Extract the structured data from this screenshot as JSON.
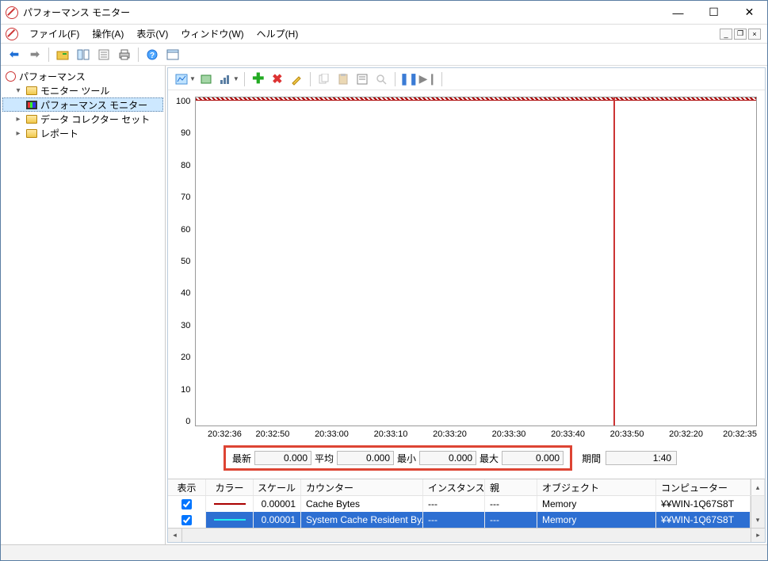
{
  "window": {
    "title": "パフォーマンス モニター"
  },
  "menu": {
    "file": "ファイル(F)",
    "action": "操作(A)",
    "view": "表示(V)",
    "window": "ウィンドウ(W)",
    "help": "ヘルプ(H)"
  },
  "tree": {
    "root": "パフォーマンス",
    "item0": "モニター ツール",
    "item0_0": "パフォーマンス モニター",
    "item1": "データ コレクター セット",
    "item2": "レポート"
  },
  "stats": {
    "latest_label": "最新",
    "latest": "0.000",
    "avg_label": "平均",
    "avg": "0.000",
    "min_label": "最小",
    "min": "0.000",
    "max_label": "最大",
    "max": "0.000",
    "period_label": "期間",
    "period": "1:40"
  },
  "list": {
    "headers": {
      "show": "表示",
      "color": "カラー",
      "scale": "スケール",
      "counter": "カウンター",
      "instance": "インスタンス",
      "parent": "親",
      "object": "オブジェクト",
      "computer": "コンピューター"
    },
    "rows": [
      {
        "scale": "0.00001",
        "counter": "Cache Bytes",
        "instance": "---",
        "parent": "---",
        "object": "Memory",
        "computer": "¥¥WIN-1Q67S8T",
        "color": "#a00"
      },
      {
        "scale": "0.00001",
        "counter": "System Cache Resident By...",
        "instance": "---",
        "parent": "---",
        "object": "Memory",
        "computer": "¥¥WIN-1Q67S8T",
        "color": "#2ee"
      }
    ]
  },
  "chart_data": {
    "type": "line",
    "title": "",
    "xlabel": "",
    "ylabel": "",
    "ylim": [
      0,
      100
    ],
    "y_ticks": [
      "100",
      "90",
      "80",
      "70",
      "60",
      "50",
      "40",
      "30",
      "20",
      "10",
      "0"
    ],
    "x_ticks": [
      "20:32:36",
      "20:32:50",
      "20:33:00",
      "20:33:10",
      "20:33:20",
      "20:33:30",
      "20:33:40",
      "20:33:50",
      "20:32:20",
      "20:32:35"
    ],
    "cursor_position_pct": 74.5,
    "series": [
      {
        "name": "Cache Bytes",
        "color": "#a00",
        "values": [
          100,
          100,
          100,
          100,
          100,
          100,
          100,
          100,
          100,
          100
        ]
      },
      {
        "name": "System Cache Resident Bytes",
        "color": "#2ee",
        "values": [
          100,
          100,
          100,
          100,
          100,
          100,
          100,
          100,
          100,
          100
        ]
      }
    ]
  }
}
